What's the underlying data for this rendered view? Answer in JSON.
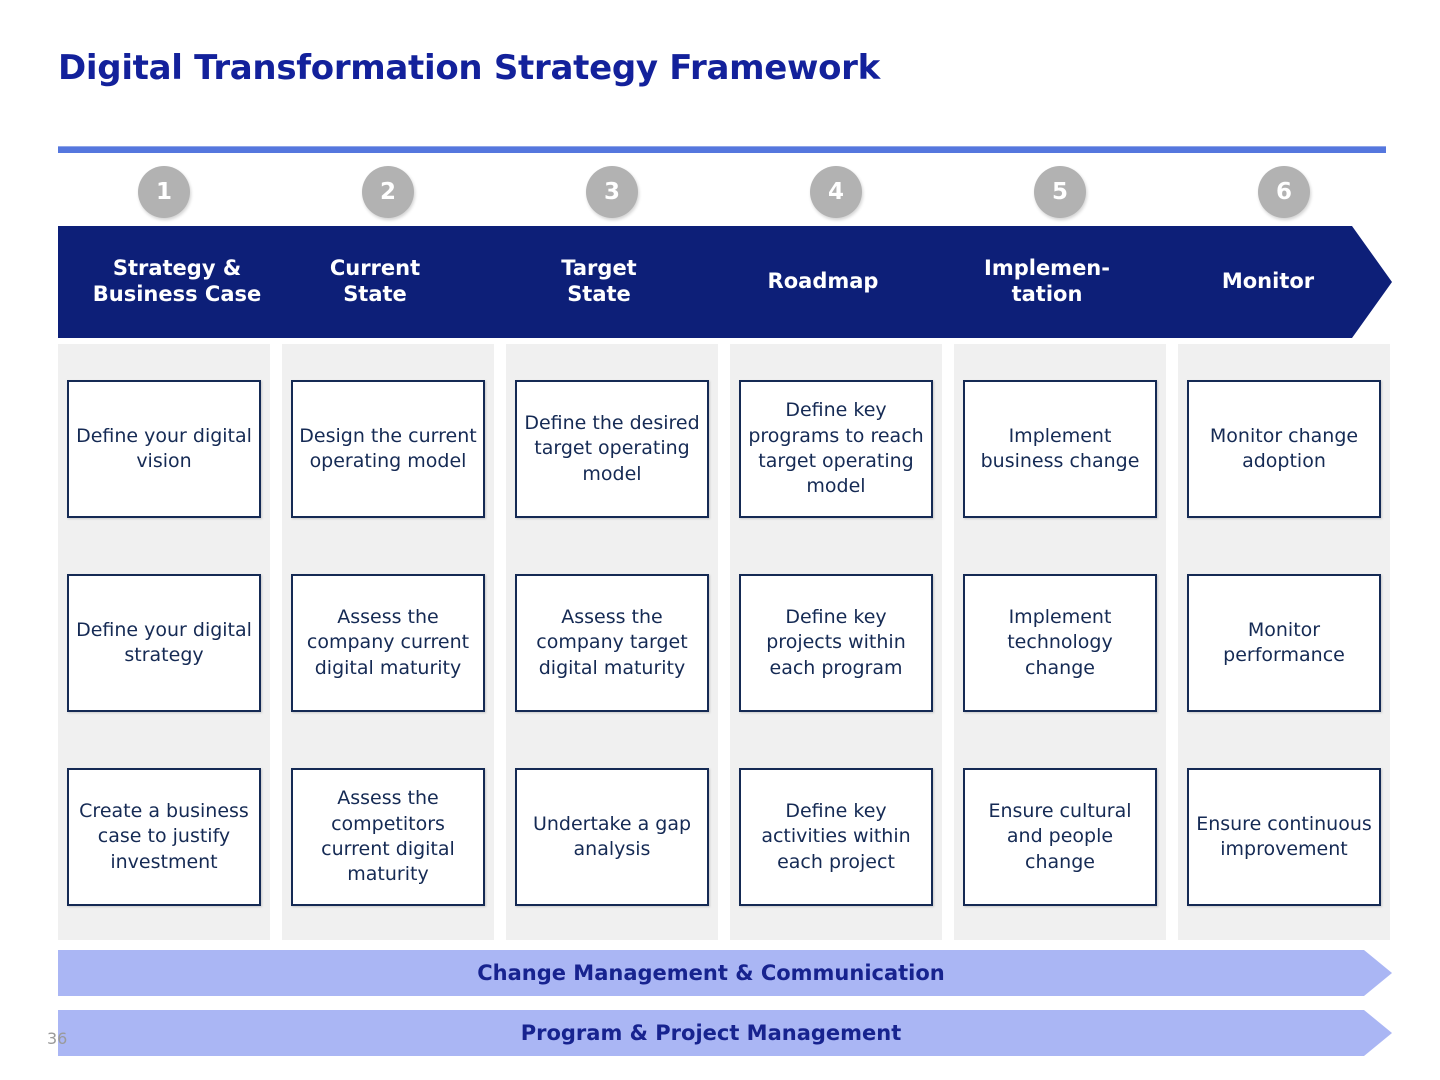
{
  "slide": {
    "title": "Digital Transformation Strategy Framework",
    "slide_number": "36",
    "accent_rule_color": "#5577de",
    "chevron_color": "#0d1f78",
    "badge_color": "#b2b2b2",
    "column_bg_color": "#f0f0f0",
    "banner_color": "#aab6f4",
    "box_border_color": "#152a54"
  },
  "stages": [
    {
      "number": "1",
      "name": "Strategy &\nBusiness Case",
      "line1": "Strategy &",
      "line2": "Business Case"
    },
    {
      "number": "2",
      "name": "Current\nState",
      "line1": "Current",
      "line2": "State"
    },
    {
      "number": "3",
      "name": "Target\nState",
      "line1": "Target",
      "line2": "State"
    },
    {
      "number": "4",
      "name": "Roadmap",
      "line1": "Roadmap",
      "line2": ""
    },
    {
      "number": "5",
      "name": "Implemen-\ntation",
      "line1": "Implemen-",
      "line2": "tation"
    },
    {
      "number": "6",
      "name": "Monitor",
      "line1": "Monitor",
      "line2": ""
    }
  ],
  "activities": {
    "row1": [
      "Define your digital vision",
      "Design the current operating model",
      "Define the desired target operating model",
      "Define key programs to reach target operating model",
      "Implement business change",
      "Monitor change adoption"
    ],
    "row2": [
      "Define your digital strategy",
      "Assess the company current digital maturity",
      "Assess the company target digital maturity",
      "Define key projects within each program",
      "Implement technology change",
      "Monitor performance"
    ],
    "row3": [
      "Create a business case to justify investment",
      "Assess the competitors current digital maturity",
      "Undertake a gap analysis",
      "Define key activities within each project",
      "Ensure cultural and people change",
      "Ensure continuous improvement"
    ]
  },
  "banners": [
    {
      "label": "Change Management & Communication"
    },
    {
      "label": "Program & Project Management"
    }
  ]
}
